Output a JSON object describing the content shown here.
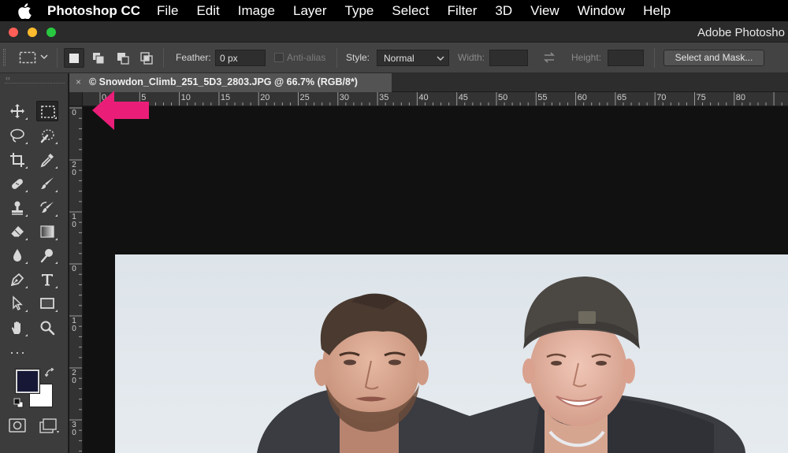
{
  "menubar": {
    "app_name": "Photoshop CC",
    "items": [
      "File",
      "Edit",
      "Image",
      "Layer",
      "Type",
      "Select",
      "Filter",
      "3D",
      "View",
      "Window",
      "Help"
    ]
  },
  "window": {
    "title": "Adobe Photosho"
  },
  "options": {
    "feather_label": "Feather:",
    "feather_value": "0 px",
    "antialias_label": "Anti-alias",
    "style_label": "Style:",
    "style_value": "Normal",
    "width_label": "Width:",
    "height_label": "Height:",
    "select_mask_label": "Select and Mask..."
  },
  "document": {
    "tab_close": "×",
    "tab_title": "© Snowdon_Climb_251_5D3_2803.JPG @ 66.7% (RGB/8*)"
  },
  "rulers": {
    "h_labels": [
      "0",
      "5",
      "10",
      "15",
      "20",
      "25",
      "30",
      "35",
      "40",
      "45",
      "50",
      "55",
      "60",
      "65",
      "70",
      "75",
      "80"
    ],
    "v_labels": [
      [
        "0"
      ],
      [
        "2",
        "0"
      ],
      [
        "1",
        "0"
      ],
      [
        "0"
      ],
      [
        "1",
        "0"
      ],
      [
        "2",
        "0"
      ],
      [
        "3",
        "0"
      ]
    ]
  },
  "toolbar": {
    "edit_toolbar_label": "···",
    "foreground_color": "#161835",
    "background_color": "#ffffff"
  },
  "colors": {
    "accent_arrow": "#ea1e78",
    "menubar_bg": "#000000",
    "panel_bg": "#3c3c3c",
    "canvas_bg": "#111111"
  }
}
